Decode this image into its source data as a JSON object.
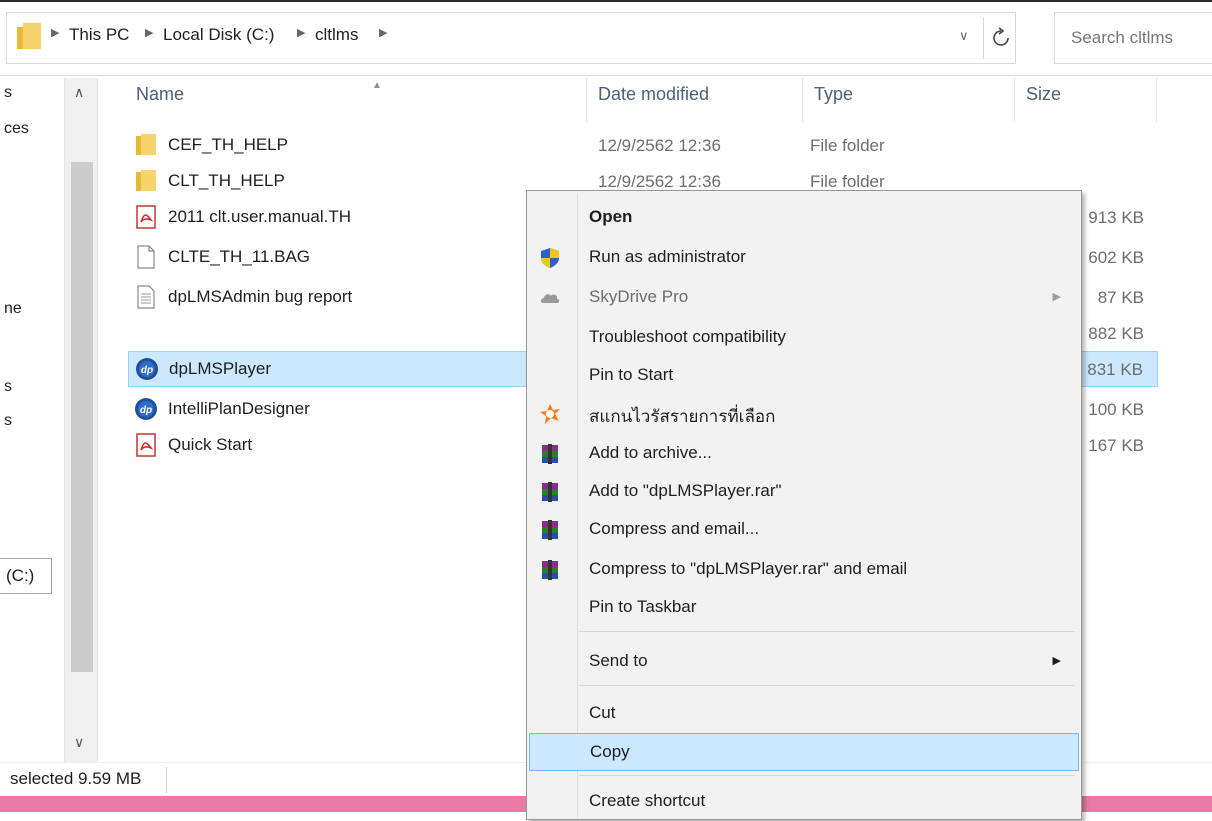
{
  "address": {
    "breadcrumbs": [
      "This PC",
      "Local Disk (C:)",
      "cltlms"
    ],
    "search_placeholder": "Search cltlms"
  },
  "nav": {
    "fragments": [
      "s",
      "ces",
      "ne",
      "s",
      "s"
    ],
    "drive_label": "(C:)"
  },
  "columns": [
    "Name",
    "Date modified",
    "Type",
    "Size"
  ],
  "files": [
    {
      "icon": "folder-icon",
      "name": "CEF_TH_HELP",
      "date": "12/9/2562 12:36",
      "type": "File folder",
      "size": ""
    },
    {
      "icon": "folder-icon",
      "name": "CLT_TH_HELP",
      "date": "12/9/2562 12:36",
      "type": "File folder",
      "size": ""
    },
    {
      "icon": "pdf-icon",
      "name": "2011 clt.user.manual.TH",
      "date": "",
      "type": "",
      "size": "913 KB"
    },
    {
      "icon": "blank-file-icon",
      "name": "CLTE_TH_11.BAG",
      "date": "",
      "type": "",
      "size": "602 KB"
    },
    {
      "icon": "text-file-icon",
      "name": "dpLMSAdmin bug report",
      "date": "",
      "type": "",
      "size": "87 KB"
    },
    {
      "icon": "",
      "name": "",
      "date": "",
      "type": "",
      "size": "882 KB"
    },
    {
      "icon": "dp-app-icon",
      "name": "dpLMSPlayer",
      "date": "",
      "type": "",
      "size": "831 KB",
      "selected": true
    },
    {
      "icon": "dp-app-icon",
      "name": "IntelliPlanDesigner",
      "date": "",
      "type": "",
      "size": "100 KB"
    },
    {
      "icon": "pdf-icon",
      "name": "Quick Start",
      "date": "",
      "type": "",
      "size": "167 KB"
    }
  ],
  "status": {
    "text": "selected  9.59 MB"
  },
  "context_menu": {
    "items": [
      {
        "label": "Open",
        "bold": true,
        "icon": ""
      },
      {
        "label": "Run as administrator",
        "icon": "uac-shield-icon"
      },
      {
        "label": "SkyDrive Pro",
        "icon": "skydrive-icon",
        "disabled": true,
        "submenu": true
      },
      {
        "label": "Troubleshoot compatibility",
        "icon": ""
      },
      {
        "label": "Pin to Start",
        "icon": ""
      },
      {
        "label": "สแกนไวรัสรายการที่เลือก",
        "icon": "avast-icon"
      },
      {
        "label": "Add to archive...",
        "icon": "winrar-icon"
      },
      {
        "label": "Add to \"dpLMSPlayer.rar\"",
        "icon": "winrar-icon"
      },
      {
        "label": "Compress and email...",
        "icon": "winrar-icon"
      },
      {
        "label": "Compress to \"dpLMSPlayer.rar\" and email",
        "icon": "winrar-icon"
      },
      {
        "label": "Pin to Taskbar",
        "icon": ""
      },
      {
        "label": "Send to",
        "icon": "",
        "submenu": true
      },
      {
        "label": "Cut",
        "icon": ""
      },
      {
        "label": "Copy",
        "icon": "",
        "highlighted": true
      },
      {
        "label": "Create shortcut",
        "icon": ""
      }
    ]
  },
  "colors": {
    "selection_bg": "#cce8ff",
    "selection_border": "#99d1ff",
    "header_text": "#4c607a",
    "taskbar": "#e87aa4"
  }
}
